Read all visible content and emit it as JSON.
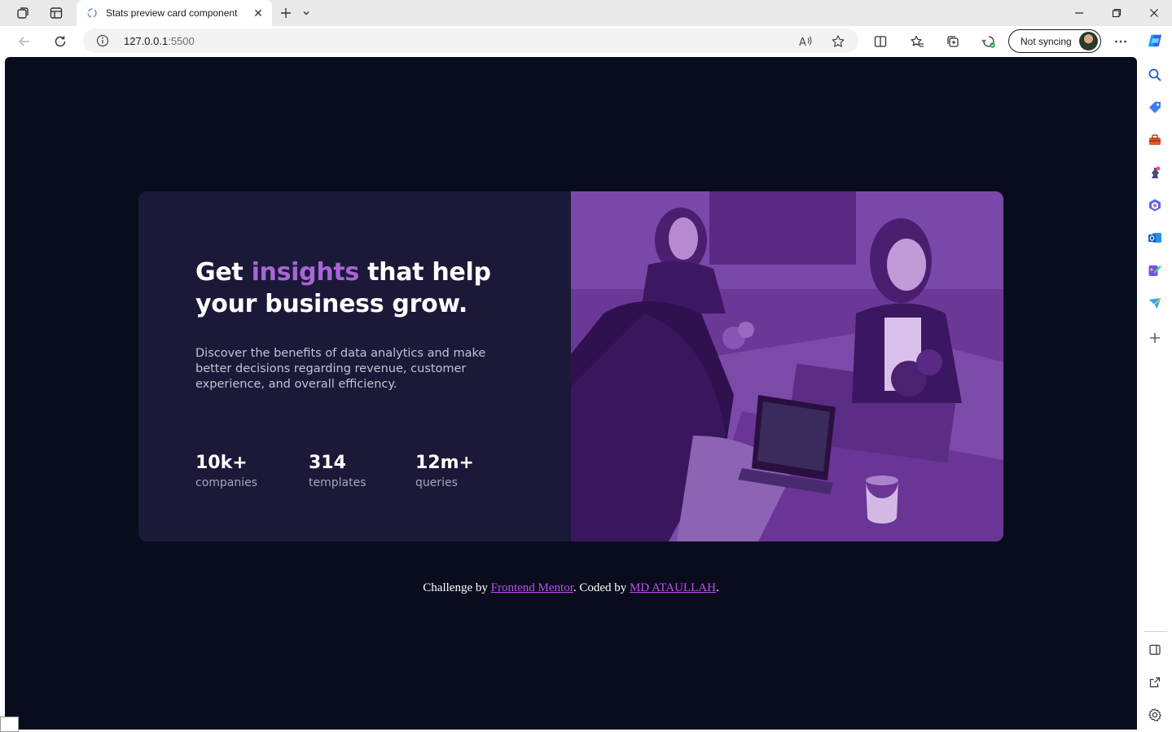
{
  "browser": {
    "tab": {
      "title": "Stats preview card component"
    },
    "address": {
      "host": "127.0.0.1",
      "port": ":5500"
    },
    "sync_label": "Not syncing"
  },
  "card": {
    "headline_before": "Get ",
    "headline_accent": "insights",
    "headline_after": " that help your business grow.",
    "description": "Discover the benefits of data analytics and make better decisions regarding revenue, customer experience, and overall efficiency.",
    "stats": [
      {
        "value": "10k+",
        "label": "companies"
      },
      {
        "value": "314",
        "label": "templates"
      },
      {
        "value": "12m+",
        "label": "queries"
      }
    ]
  },
  "attribution": {
    "prefix": "Challenge by ",
    "link1": "Frontend Mentor",
    "middle": ". Coded by ",
    "link2": "MD ATAULLAH",
    "suffix": "."
  },
  "colors": {
    "page_bg": "#090c1d",
    "card_bg": "#1b1938",
    "accent": "#a865d8",
    "image_overlay": "#6d3a9a",
    "link": "#c24df2"
  },
  "icons": {
    "titlebar": [
      "workspaces-icon",
      "tab-actions-icon",
      "new-tab-icon",
      "tab-list-chevron-icon"
    ],
    "toolbar": [
      "back-icon",
      "refresh-icon",
      "site-info-icon",
      "read-aloud-icon",
      "favorite-star-icon",
      "split-screen-icon",
      "favorites-icon",
      "collections-icon",
      "browser-essentials-icon",
      "more-icon"
    ],
    "sidebar": [
      "copilot-icon",
      "search-icon",
      "shopping-icon",
      "tools-icon",
      "games-icon",
      "microsoft-365-icon",
      "outlook-icon",
      "designer-icon",
      "send-icon",
      "add-icon",
      "hide-sidebar-icon",
      "external-link-icon",
      "settings-icon"
    ]
  }
}
